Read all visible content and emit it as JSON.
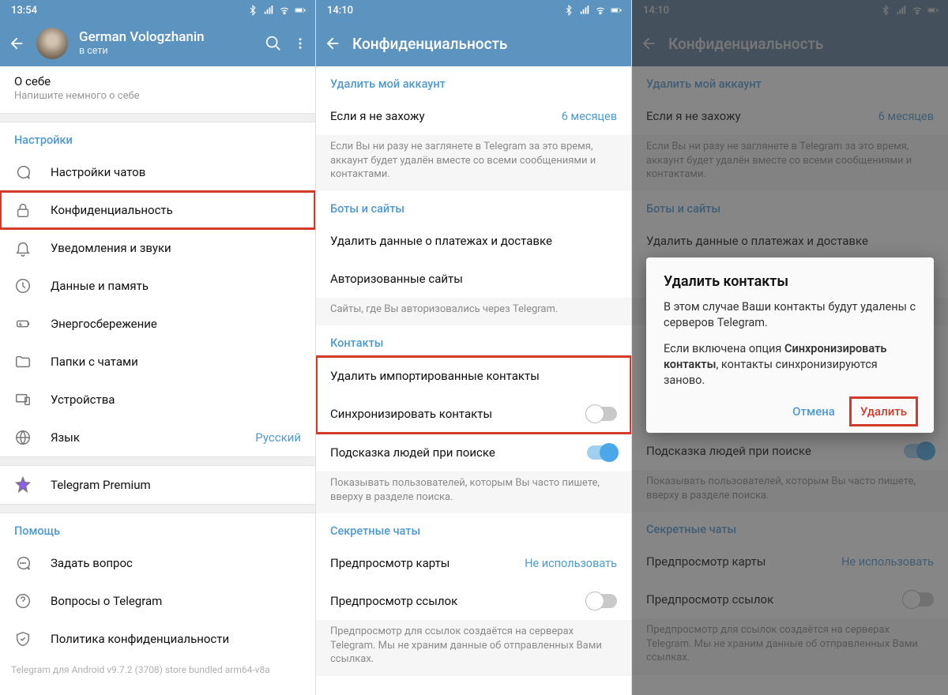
{
  "colors": {
    "header": "#5c93bf",
    "accent": "#4e9ad4",
    "danger": "#d13b2a"
  },
  "p1": {
    "time": "13:54",
    "user_name": "German Vologzhanin",
    "user_status": "в сети",
    "bio_title": "О себе",
    "bio_hint": "Напишите немного о себе",
    "sec_settings": "Настройки",
    "items": {
      "chats": "Настройки чатов",
      "privacy": "Конфиденциальность",
      "notif": "Уведомления и звуки",
      "data": "Данные и память",
      "power": "Энергосбережение",
      "folders": "Папки с чатами",
      "devices": "Устройства",
      "lang": "Язык",
      "lang_val": "Русский",
      "premium": "Telegram Premium"
    },
    "sec_help": "Помощь",
    "help": {
      "ask": "Задать вопрос",
      "faq": "Вопросы о Telegram",
      "policy": "Политика конфиденциальности"
    },
    "version": "Telegram для Android v9.7.2 (3708) store bundled arm64-v8a"
  },
  "p2": {
    "time": "14:10",
    "title": "Конфиденциальность",
    "sec_delete": "Удалить мой аккаунт",
    "away_label": "Если я не захожу",
    "away_value": "6 месяцев",
    "away_note": "Если Вы ни разу не заглянете в Telegram за это время, аккаунт будет удалён вместе со всеми сообщениями и контактами.",
    "sec_bots": "Боты и сайты",
    "payments": "Удалить данные о платежах и доставке",
    "sites": "Авторизованные сайты",
    "sites_note": "Сайты, где Вы авторизовались через Telegram.",
    "sec_contacts": "Контакты",
    "del_imported": "Удалить импортированные контакты",
    "sync": "Синхронизировать контакты",
    "suggest": "Подсказка людей при поиске",
    "suggest_note": "Показывать пользователей, которым Вы часто пишете, вверху в разделе поиска.",
    "sec_secret": "Секретные чаты",
    "map_preview": "Предпросмотр карты",
    "map_value": "Не использовать",
    "link_preview": "Предпросмотр ссылок",
    "link_note": "Предпросмотр для ссылок создаётся на серверах Telegram. Мы не храним данные об отправленных Вами ссылках."
  },
  "p3": {
    "dialog_title": "Удалить контакты",
    "dialog_body1": "В этом случае Ваши контакты будут удалены с серверов Telegram.",
    "dialog_body2a": "Если включена опция ",
    "dialog_body2b": "Синхронизировать контакты",
    "dialog_body2c": ", контакты синхронизируются заново.",
    "cancel": "Отмена",
    "confirm": "Удалить"
  }
}
